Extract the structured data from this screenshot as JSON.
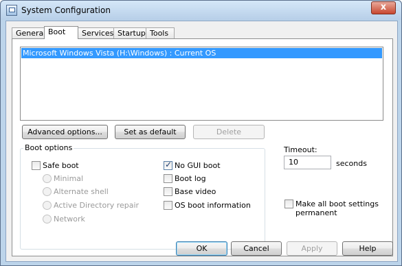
{
  "window": {
    "title": "System Configuration",
    "close_glyph": "x"
  },
  "tabs": [
    {
      "label": "General"
    },
    {
      "label": "Boot"
    },
    {
      "label": "Services"
    },
    {
      "label": "Startup"
    },
    {
      "label": "Tools"
    }
  ],
  "active_tab": "Boot",
  "os_list": {
    "items": [
      "Microsoft Windows Vista (H:\\Windows) : Current OS"
    ],
    "selected_index": 0
  },
  "buttons_row": {
    "advanced": "Advanced options...",
    "set_default": "Set as default",
    "delete": "Delete"
  },
  "boot_options": {
    "title": "Boot options",
    "safe_boot": {
      "label": "Safe boot",
      "checked": false
    },
    "radios": [
      {
        "label": "Minimal"
      },
      {
        "label": "Alternate shell"
      },
      {
        "label": "Active Directory repair"
      },
      {
        "label": "Network"
      }
    ],
    "no_gui_boot": {
      "label": "No GUI boot",
      "checked": true
    },
    "boot_log": {
      "label": "Boot log",
      "checked": false
    },
    "base_video": {
      "label": "Base video",
      "checked": false
    },
    "os_boot_info": {
      "label": "OS boot information",
      "checked": false
    }
  },
  "timeout": {
    "label": "Timeout:",
    "value": "10",
    "unit": "seconds"
  },
  "make_permanent": {
    "label_line1": "Make all boot settings",
    "label_line2": "permanent",
    "checked": false
  },
  "dialog_buttons": {
    "ok": "OK",
    "cancel": "Cancel",
    "apply": "Apply",
    "help": "Help"
  },
  "colors": {
    "selection": "#3399ff",
    "title_bar": "#d5e7f8",
    "close_button": "#c8472f"
  },
  "icons": {
    "app": "system-config-icon",
    "checkmark": "✓"
  }
}
